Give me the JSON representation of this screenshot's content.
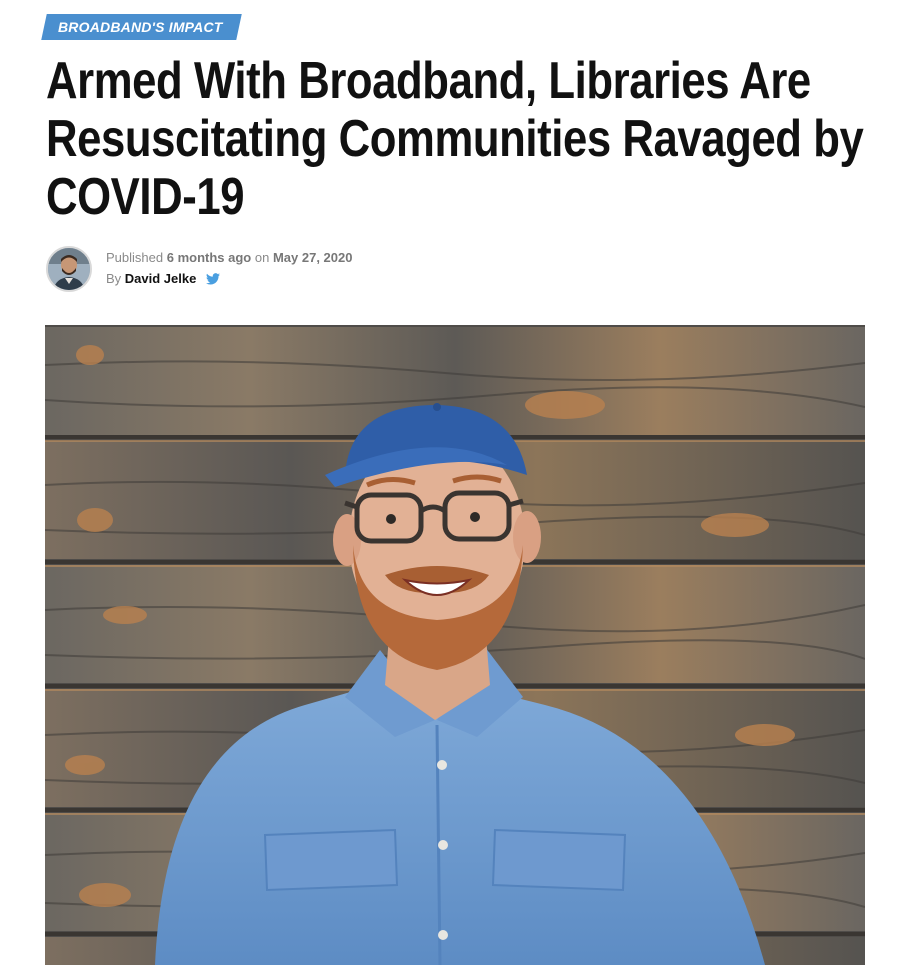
{
  "category": {
    "label": "BROADBAND'S IMPACT",
    "color": "#4a8fcf"
  },
  "article": {
    "title": "Armed With Broadband, Libraries Are Resuscitating Communities Ravaged by COVID-19",
    "published_prefix": "Published",
    "published_relative": "6 months ago",
    "published_on": "on",
    "published_date": "May 27, 2020",
    "by_prefix": "By",
    "author": "David Jelke"
  },
  "icons": {
    "author_avatar": "author-avatar",
    "twitter": "twitter-icon"
  },
  "colors": {
    "twitter": "#4a9fe0",
    "headline": "#111111"
  }
}
